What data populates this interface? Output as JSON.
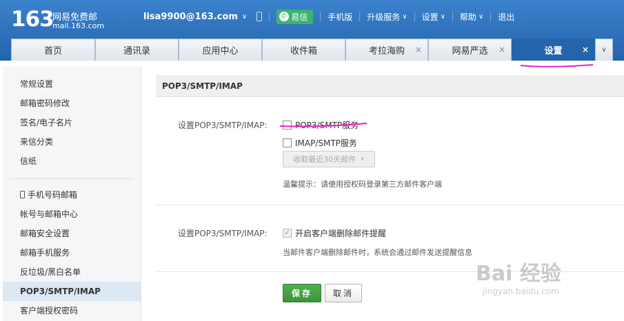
{
  "header": {
    "logo_number": "163",
    "logo_name": "网易免费邮",
    "logo_domain": "mail.163.com",
    "user_email": "lisa9900@163.com",
    "nav": {
      "yixin": "易信",
      "mobile": "手机版",
      "upgrade": "升级服务",
      "settings": "设置",
      "help": "帮助",
      "logout": "退出"
    },
    "brand_color": "#2563ad"
  },
  "tabs": [
    {
      "label": "首页",
      "closable": false
    },
    {
      "label": "通讯录",
      "closable": false
    },
    {
      "label": "应用中心",
      "closable": false
    },
    {
      "label": "收件箱",
      "closable": false
    },
    {
      "label": "考拉海购",
      "closable": true
    },
    {
      "label": "网易严选",
      "closable": true
    },
    {
      "label": "设置",
      "closable": true,
      "active": true
    }
  ],
  "tab_close_glyph": "×",
  "sidebar": {
    "group1": [
      "常规设置",
      "邮箱密码修改",
      "签名/电子名片",
      "来信分类",
      "信纸"
    ],
    "group2": [
      "手机号码邮箱",
      "帐号与邮箱中心",
      "邮箱安全设置",
      "邮箱手机服务",
      "反垃圾/黑白名单",
      "POP3/SMTP/IMAP",
      "客户端授权密码"
    ],
    "active_item": "POP3/SMTP/IMAP"
  },
  "main": {
    "title": "POP3/SMTP/IMAP",
    "section1": {
      "label": "设置POP3/SMTP/IMAP:",
      "option_pop3": "POP3/SMTP服务",
      "option_imap": "IMAP/SMTP服务",
      "select_value": "收取最近30天邮件",
      "hint": "温馨提示：请使用授权码登录第三方邮件客户端"
    },
    "section2": {
      "label": "设置POP3/SMTP/IMAP:",
      "option_delete_notify": "开启客户端删除邮件提醒",
      "hint": "当邮件客户端删除邮件时，系统会通过邮件发送提醒信息"
    },
    "save_button": "保存",
    "cancel_button": "取消"
  },
  "watermark": {
    "logo": "Bai 经验",
    "url": "jingyan.baidu.com"
  }
}
